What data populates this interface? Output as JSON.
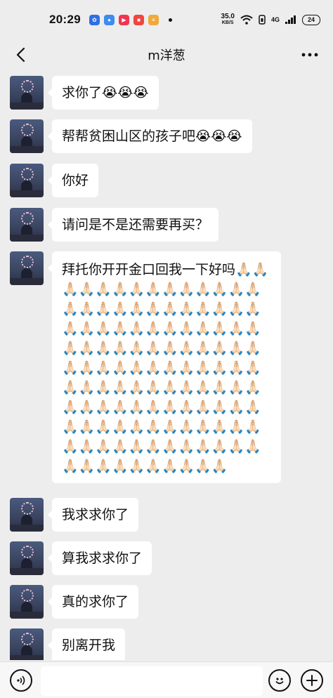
{
  "status_bar": {
    "time": "20:29",
    "app_icons": [
      {
        "name": "baidu-icon",
        "color": "#2f6fe0",
        "glyph": "🐾"
      },
      {
        "name": "app-blue-icon",
        "color": "#3b8df0",
        "glyph": "●"
      },
      {
        "name": "video-app-icon",
        "color": "#f0364f",
        "glyph": "▶"
      },
      {
        "name": "red-app-icon",
        "color": "#f2453d",
        "glyph": "■"
      },
      {
        "name": "stripe-app-icon",
        "color": "#f0a93b",
        "glyph": "≡"
      }
    ],
    "net_speed": "35.0",
    "net_unit": "KB/S",
    "net_type": "4G",
    "battery": "24"
  },
  "header": {
    "title": "m洋葱",
    "back_icon": "chevron-left-icon",
    "more_icon": "more-icon"
  },
  "messages": [
    {
      "text": "求你了😭😭😭"
    },
    {
      "text": "帮帮贫困山区的孩子吧😭😭😭"
    },
    {
      "text": "你好"
    },
    {
      "text": "请问是不是还需要再买？"
    },
    {
      "text": "拜托你开开金口回我一下好吗🙏🏻🙏🏻🙏🏻🙏🏻🙏🏻🙏🏻🙏🏻🙏🏻🙏🏻🙏🏻🙏🏻🙏🏻🙏🏻🙏🏻🙏🏻🙏🏻🙏🏻🙏🏻🙏🏻🙏🏻🙏🏻🙏🏻🙏🏻🙏🏻🙏🏻🙏🏻🙏🏻🙏🏻🙏🏻🙏🏻🙏🏻🙏🏻🙏🏻🙏🏻🙏🏻🙏🏻🙏🏻🙏🏻🙏🏻🙏🏻🙏🏻🙏🏻🙏🏻🙏🏻🙏🏻🙏🏻🙏🏻🙏🏻🙏🏻🙏🏻🙏🏻🙏🏻🙏🏻🙏🏻🙏🏻🙏🏻🙏🏻🙏🏻🙏🏻🙏🏻🙏🏻🙏🏻🙏🏻🙏🏻🙏🏻🙏🏻🙏🏻🙏🏻🙏🏻🙏🏻🙏🏻🙏🏻🙏🏻🙏🏻🙏🏻🙏🏻🙏🏻🙏🏻🙏🏻🙏🏻🙏🏻🙏🏻🙏🏻🙏🏻🙏🏻🙏🏻🙏🏻🙏🏻🙏🏻🙏🏻🙏🏻🙏🏻🙏🏻🙏🏻🙏🏻🙏🏻🙏🏻🙏🏻🙏🏻🙏🏻🙏🏻🙏🏻🙏🏻🙏🏻🙏🏻🙏🏻🙏🏻🙏🏻🙏🏻🙏🏻🙏🏻🙏🏻🙏🏻🙏🏻🙏🏻🙏🏻🙏🏻🙏🏻🙏🏻🙏🏻"
    },
    {
      "text": "我求求你了"
    },
    {
      "text": "算我求求你了"
    },
    {
      "text": "真的求你了"
    },
    {
      "text": "别离开我"
    }
  ],
  "input_bar": {
    "voice_icon": "voice-icon",
    "emoji_icon": "emoji-icon",
    "plus_icon": "plus-icon",
    "placeholder": ""
  },
  "colors": {
    "background": "#ededed",
    "bubble": "#ffffff",
    "input_bar": "#f7f7f7"
  }
}
